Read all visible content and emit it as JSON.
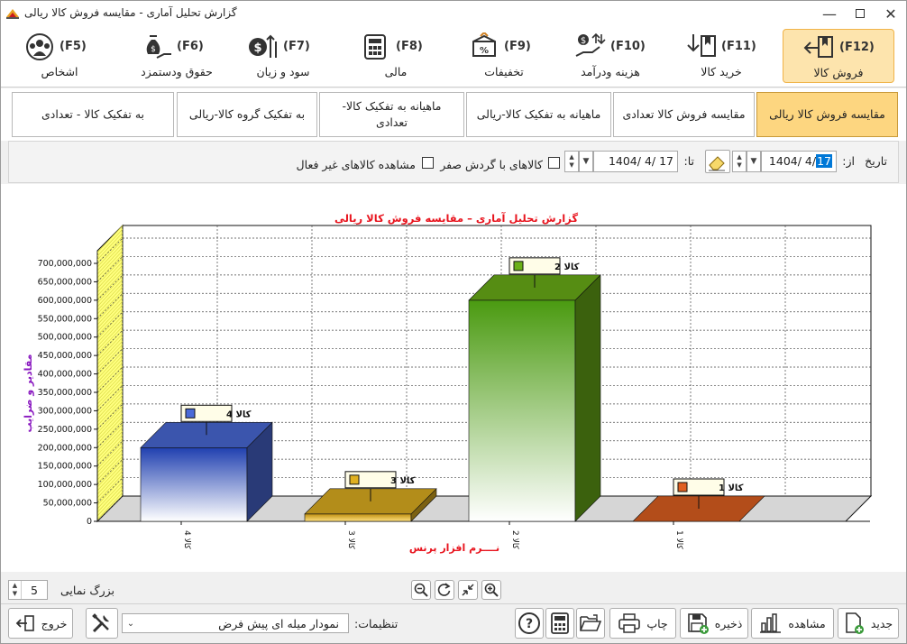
{
  "window": {
    "title": "گزارش تحلیل آماری - مقایسه فروش کالا ریالی"
  },
  "top_tabs": [
    {
      "key": "(F12)",
      "label": "فروش کالا",
      "icon": "arrow-left-bookmark-icon",
      "selected": true
    },
    {
      "key": "(F11)",
      "label": "خرید کالا",
      "icon": "arrow-down-bookmark-icon",
      "selected": false
    },
    {
      "key": "(F10)",
      "label": "هزینه ودرآمد",
      "icon": "hand-coins-icon",
      "selected": false
    },
    {
      "key": "(F9)",
      "label": "تخفیفات",
      "icon": "discount-box-icon",
      "selected": false
    },
    {
      "key": "(F8)",
      "label": "مالی",
      "icon": "calculator-icon",
      "selected": false
    },
    {
      "key": "(F7)",
      "label": "سود و زیان",
      "icon": "dollar-arrows-icon",
      "selected": false
    },
    {
      "key": "(F6)",
      "label": "حقوق ودستمزد",
      "icon": "money-bag-hand-icon",
      "selected": false
    },
    {
      "key": "(F5)",
      "label": "اشخاص",
      "icon": "people-group-icon",
      "selected": false
    }
  ],
  "sub_tabs": [
    {
      "label": "مقایسه فروش کالا ریالی",
      "selected": true
    },
    {
      "label": "مقایسه فروش کالا تعدادی",
      "selected": false
    },
    {
      "label": "ماهیانه به تفکیک کالا-ریالی",
      "selected": false
    },
    {
      "label": "ماهیانه به تفکیک کالا-تعدادی",
      "selected": false
    },
    {
      "label": "به تفکیک گروه کالا-ریالی",
      "selected": false
    },
    {
      "label": "به تفکیک کالا - تعدادی",
      "selected": false
    }
  ],
  "filter": {
    "date_label": "تاریخ",
    "from_label": "از:",
    "from_value": "1404/ 4/",
    "from_value_selected": "17",
    "to_label": "تا:",
    "to_value": "1404/ 4/ 17",
    "zero_turnover_label": "کالاهای با گردش صفر",
    "zero_turnover_checked": false,
    "inactive_label": "مشاهده کالاهای غیر فعال",
    "inactive_checked": false
  },
  "chart_data": {
    "type": "bar",
    "title": "گزارش تحلیل آماری – مقایسه فروش کالا ریالی",
    "ylabel": "مقادیر و ضرایب",
    "footer": "نــــرم افزار پرنس",
    "categories": [
      "کالا 4",
      "کالا 3",
      "کالا 2",
      "کالا 1"
    ],
    "values": [
      200000000,
      20000000,
      600000000,
      0
    ],
    "point_labels": [
      "کالا 4",
      "کالا 3",
      "کالا 2",
      "کالا 1"
    ],
    "colors": [
      "#4a6ad8",
      "#e0b020",
      "#6bb018",
      "#e06020"
    ],
    "ylim": [
      0,
      700000000
    ],
    "yticks": [
      "0",
      "50,000,000",
      "100,000,000",
      "150,000,000",
      "200,000,000",
      "250,000,000",
      "300,000,000",
      "350,000,000",
      "400,000,000",
      "450,000,000",
      "500,000,000",
      "550,000,000",
      "600,000,000",
      "650,000,000",
      "700,000,000"
    ],
    "grid": true
  },
  "zoom": {
    "label": "بزرگ نمایی",
    "value": "5"
  },
  "settings": {
    "label": "تنظیمات:",
    "value": "نمودار میله ای پیش فرض"
  },
  "buttons": {
    "new": "جدید",
    "view": "مشاهده",
    "save": "ذخیره",
    "print": "چاپ",
    "exit": "خروج"
  },
  "colors": {
    "accent": "#fde4ad",
    "selected_subtab": "#fdd680",
    "title_red": "#e8141e",
    "ylabel_purple": "#8a1ac0"
  }
}
